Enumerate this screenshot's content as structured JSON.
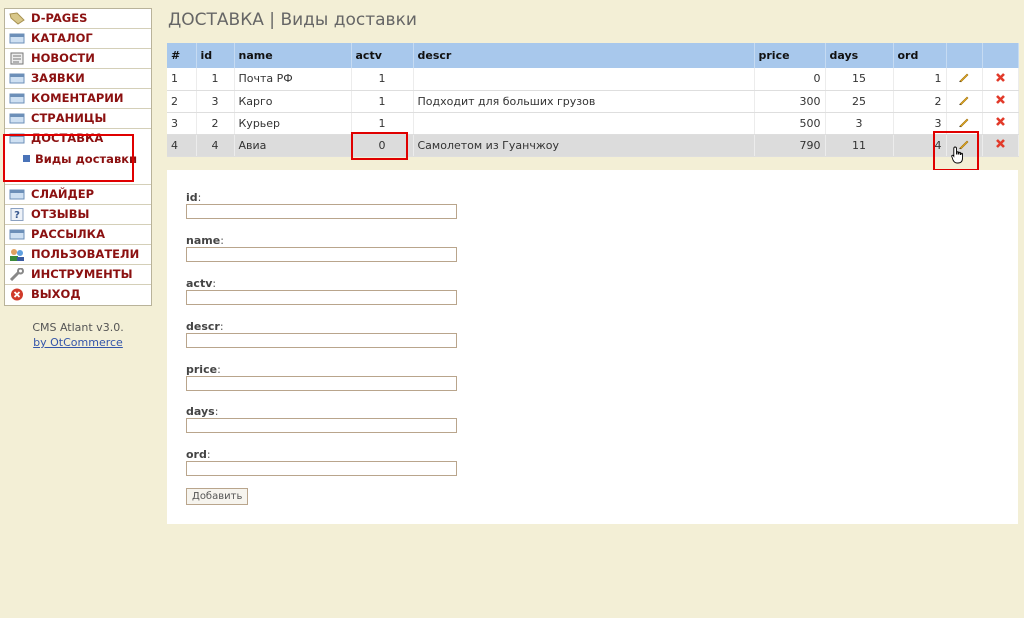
{
  "sidebar": {
    "items": [
      {
        "label": "D-PAGES",
        "icon": "tag-icon"
      },
      {
        "label": "КАТАЛОГ",
        "icon": "catalog-icon"
      },
      {
        "label": "НОВОСТИ",
        "icon": "news-icon"
      },
      {
        "label": "ЗАЯВКИ",
        "icon": "orders-icon"
      },
      {
        "label": "КОМЕНТАРИИ",
        "icon": "comments-icon"
      },
      {
        "label": "СТРАНИЦЫ",
        "icon": "pages-icon"
      },
      {
        "label": "ДОСТАВКА",
        "icon": "delivery-icon",
        "sub": "Виды доставки"
      },
      {
        "label": "СЛАЙДЕР",
        "icon": "slider-icon"
      },
      {
        "label": "ОТЗЫВЫ",
        "icon": "help-icon"
      },
      {
        "label": "РАССЫЛКА",
        "icon": "mailing-icon"
      },
      {
        "label": "ПОЛЬЗОВАТЕЛИ",
        "icon": "users-icon"
      },
      {
        "label": "ИНСТРУМЕНТЫ",
        "icon": "wrench-icon"
      },
      {
        "label": "ВЫХОД",
        "icon": "exit-icon"
      }
    ],
    "credit_line1": "CMS Atlant v3.0.",
    "credit_link": "by OtCommerce"
  },
  "page": {
    "title": "ДОСТАВКА | Виды доставки"
  },
  "table": {
    "columns": [
      "#",
      "id",
      "name",
      "actv",
      "descr",
      "price",
      "days",
      "ord"
    ],
    "rows": [
      [
        "1",
        "1",
        "Почта РФ",
        "1",
        "",
        "0",
        "15",
        "1"
      ],
      [
        "2",
        "3",
        "Карго",
        "1",
        "Подходит для больших грузов",
        "300",
        "25",
        "2"
      ],
      [
        "3",
        "2",
        "Курьер",
        "1",
        "",
        "500",
        "3",
        "3"
      ],
      [
        "4",
        "4",
        "Авиа",
        "0",
        "Самолетом из Гуанчжоу",
        "790",
        "11",
        "4"
      ]
    ]
  },
  "form": {
    "fields": [
      "id",
      "name",
      "actv",
      "descr",
      "price",
      "days",
      "ord"
    ],
    "submit_label": "Добавить"
  },
  "colors": {
    "background": "#f3efd6",
    "menu_text": "#8b1010",
    "table_header": "#a8c8ec",
    "highlight": "#e00000"
  }
}
